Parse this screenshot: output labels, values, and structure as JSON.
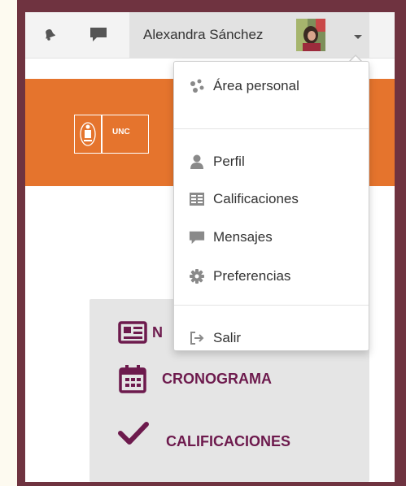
{
  "user": {
    "name": "Alexandra Sánchez"
  },
  "navbar": {
    "icons": [
      "bell-icon",
      "chat-bubble-icon",
      "caret-down-icon"
    ]
  },
  "logo": {
    "text": "UNC"
  },
  "dropdown_menu": {
    "dashboard_label": "Área personal",
    "profile_label": "Perfil",
    "grades_label": "Calificaciones",
    "messages_label": "Mensajes",
    "preferences_label": "Preferencias",
    "logout_label": "Salir"
  },
  "panel": {
    "item1_label": "N",
    "item2_label": "CRONOGRAMA",
    "item3_label": "CALIFICACIONES"
  },
  "colors": {
    "frame": "#6f3340",
    "accent_orange": "#e5742d",
    "panel_text": "#6d1a4d",
    "icon_gray": "#8a8a8a"
  }
}
